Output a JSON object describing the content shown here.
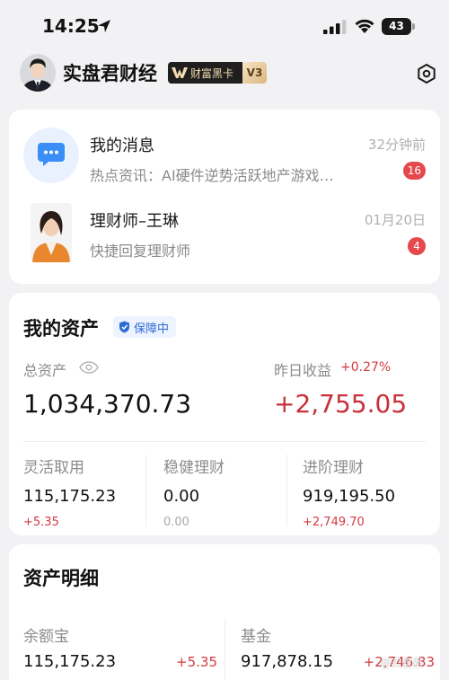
{
  "status_bar": {
    "time": "14:25",
    "battery": "43"
  },
  "profile": {
    "name": "实盘君财经",
    "vip_card": "财富黑卡",
    "vip_level": "V3"
  },
  "messages": [
    {
      "title": "我的消息",
      "time": "32分钟前",
      "preview": "热点资讯：AI硬件逆势活跃地产游戏…",
      "badge": "16"
    },
    {
      "title": "理财师–王琳",
      "time": "01月20日",
      "preview": "快捷回复理财师",
      "badge": "4"
    }
  ],
  "assets": {
    "title": "我的资产",
    "protect_tag": "保障中",
    "total_label": "总资产",
    "total_value": "1,034,370.73",
    "yesterday_label": "昨日收益",
    "yesterday_rate": "+0.27%",
    "yesterday_value": "+2,755.05",
    "columns": [
      {
        "label": "灵活取用",
        "value": "115,175.23",
        "delta": "+5.35"
      },
      {
        "label": "稳健理财",
        "value": "0.00",
        "delta": "0.00"
      },
      {
        "label": "进阶理财",
        "value": "919,195.50",
        "delta": "+2,749.70"
      }
    ]
  },
  "detail": {
    "title": "资产明细",
    "items": [
      {
        "label": "余额宝",
        "value": "115,175.23",
        "delta": "+5.35"
      },
      {
        "label": "基金",
        "value": "917,878.15",
        "delta": "+2,746.83"
      }
    ]
  },
  "watermark": "@实盘君"
}
